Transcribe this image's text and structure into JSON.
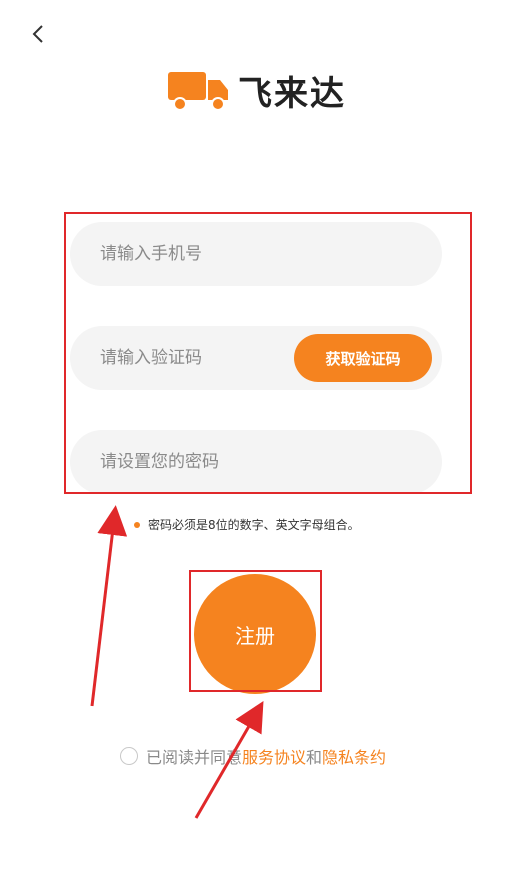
{
  "nav": {
    "back_icon": "chevron-left-icon"
  },
  "brand": {
    "name": "飞来达",
    "logo_icon": "truck-icon",
    "color": "#f5831f"
  },
  "form": {
    "phone_placeholder": "请输入手机号",
    "code_placeholder": "请输入验证码",
    "get_code_label": "获取验证码",
    "password_placeholder": "请设置您的密码",
    "password_hint": "密码必须是8位的数字、英文字母组合。"
  },
  "register": {
    "label": "注册"
  },
  "agreement": {
    "prefix": "已阅读并同意",
    "terms": "服务协议",
    "and": "和",
    "privacy": "隐私条约",
    "checked": false
  },
  "annotation": {
    "color": "#e0282a"
  }
}
